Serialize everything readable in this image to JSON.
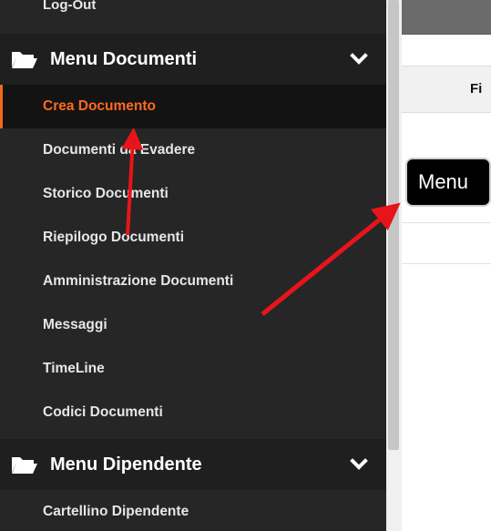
{
  "sidebar": {
    "top_item": "Log-Out",
    "sections": [
      {
        "title": "Menu Documenti",
        "items": [
          {
            "label": "Crea Documento",
            "active": true
          },
          {
            "label": "Documenti da Evadere"
          },
          {
            "label": "Storico Documenti"
          },
          {
            "label": "Riepilogo Documenti"
          },
          {
            "label": "Amministrazione Documenti"
          },
          {
            "label": "Messaggi"
          },
          {
            "label": "TimeLine"
          },
          {
            "label": "Codici Documenti"
          }
        ]
      },
      {
        "title": "Menu Dipendente",
        "items": [
          {
            "label": "Cartellino Dipendente"
          }
        ]
      }
    ]
  },
  "content": {
    "table_header_text": "Fi",
    "menu_button_label": "Menu"
  },
  "colors": {
    "sidebar_bg": "#262626",
    "active_accent": "#ff6a1c",
    "annotation_arrow": "#e8141b"
  }
}
